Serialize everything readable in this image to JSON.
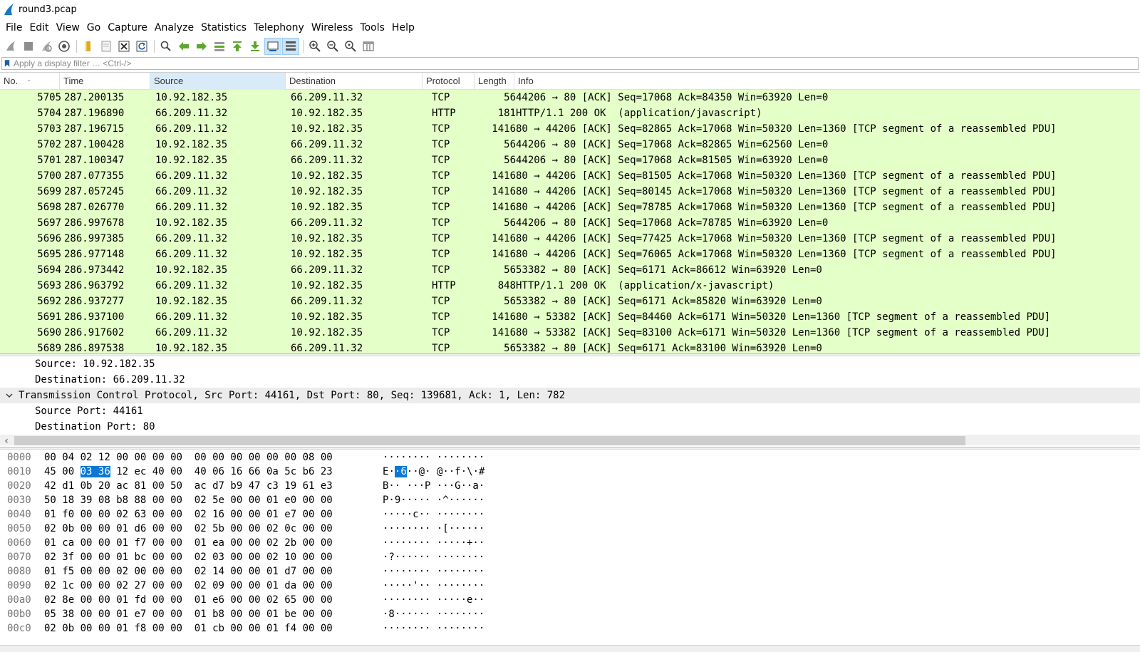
{
  "window": {
    "title": "round3.pcap"
  },
  "menu": [
    "File",
    "Edit",
    "View",
    "Go",
    "Capture",
    "Analyze",
    "Statistics",
    "Telephony",
    "Wireless",
    "Tools",
    "Help"
  ],
  "filter": {
    "placeholder": "Apply a display filter … <Ctrl-/>",
    "value": ""
  },
  "columns": [
    "No.",
    "Time",
    "Source",
    "Destination",
    "Protocol",
    "Length",
    "Info"
  ],
  "packets": [
    {
      "no": "5705",
      "time": "287.200135",
      "src": "10.92.182.35",
      "dst": "66.209.11.32",
      "proto": "TCP",
      "len": "56",
      "info": "44206 → 80 [ACK] Seq=17068 Ack=84350 Win=63920 Len=0"
    },
    {
      "no": "5704",
      "time": "287.196890",
      "src": "66.209.11.32",
      "dst": "10.92.182.35",
      "proto": "HTTP",
      "len": "181",
      "info": "HTTP/1.1 200 OK  (application/javascript)"
    },
    {
      "no": "5703",
      "time": "287.196715",
      "src": "66.209.11.32",
      "dst": "10.92.182.35",
      "proto": "TCP",
      "len": "1416",
      "info": "80 → 44206 [ACK] Seq=82865 Ack=17068 Win=50320 Len=1360 [TCP segment of a reassembled PDU]"
    },
    {
      "no": "5702",
      "time": "287.100428",
      "src": "10.92.182.35",
      "dst": "66.209.11.32",
      "proto": "TCP",
      "len": "56",
      "info": "44206 → 80 [ACK] Seq=17068 Ack=82865 Win=62560 Len=0"
    },
    {
      "no": "5701",
      "time": "287.100347",
      "src": "10.92.182.35",
      "dst": "66.209.11.32",
      "proto": "TCP",
      "len": "56",
      "info": "44206 → 80 [ACK] Seq=17068 Ack=81505 Win=63920 Len=0"
    },
    {
      "no": "5700",
      "time": "287.077355",
      "src": "66.209.11.32",
      "dst": "10.92.182.35",
      "proto": "TCP",
      "len": "1416",
      "info": "80 → 44206 [ACK] Seq=81505 Ack=17068 Win=50320 Len=1360 [TCP segment of a reassembled PDU]"
    },
    {
      "no": "5699",
      "time": "287.057245",
      "src": "66.209.11.32",
      "dst": "10.92.182.35",
      "proto": "TCP",
      "len": "1416",
      "info": "80 → 44206 [ACK] Seq=80145 Ack=17068 Win=50320 Len=1360 [TCP segment of a reassembled PDU]"
    },
    {
      "no": "5698",
      "time": "287.026770",
      "src": "66.209.11.32",
      "dst": "10.92.182.35",
      "proto": "TCP",
      "len": "1416",
      "info": "80 → 44206 [ACK] Seq=78785 Ack=17068 Win=50320 Len=1360 [TCP segment of a reassembled PDU]"
    },
    {
      "no": "5697",
      "time": "286.997678",
      "src": "10.92.182.35",
      "dst": "66.209.11.32",
      "proto": "TCP",
      "len": "56",
      "info": "44206 → 80 [ACK] Seq=17068 Ack=78785 Win=63920 Len=0"
    },
    {
      "no": "5696",
      "time": "286.997385",
      "src": "66.209.11.32",
      "dst": "10.92.182.35",
      "proto": "TCP",
      "len": "1416",
      "info": "80 → 44206 [ACK] Seq=77425 Ack=17068 Win=50320 Len=1360 [TCP segment of a reassembled PDU]"
    },
    {
      "no": "5695",
      "time": "286.977148",
      "src": "66.209.11.32",
      "dst": "10.92.182.35",
      "proto": "TCP",
      "len": "1416",
      "info": "80 → 44206 [ACK] Seq=76065 Ack=17068 Win=50320 Len=1360 [TCP segment of a reassembled PDU]"
    },
    {
      "no": "5694",
      "time": "286.973442",
      "src": "10.92.182.35",
      "dst": "66.209.11.32",
      "proto": "TCP",
      "len": "56",
      "info": "53382 → 80 [ACK] Seq=6171 Ack=86612 Win=63920 Len=0"
    },
    {
      "no": "5693",
      "time": "286.963792",
      "src": "66.209.11.32",
      "dst": "10.92.182.35",
      "proto": "HTTP",
      "len": "848",
      "info": "HTTP/1.1 200 OK  (application/x-javascript)"
    },
    {
      "no": "5692",
      "time": "286.937277",
      "src": "10.92.182.35",
      "dst": "66.209.11.32",
      "proto": "TCP",
      "len": "56",
      "info": "53382 → 80 [ACK] Seq=6171 Ack=85820 Win=63920 Len=0"
    },
    {
      "no": "5691",
      "time": "286.937100",
      "src": "66.209.11.32",
      "dst": "10.92.182.35",
      "proto": "TCP",
      "len": "1416",
      "info": "80 → 53382 [ACK] Seq=84460 Ack=6171 Win=50320 Len=1360 [TCP segment of a reassembled PDU]"
    },
    {
      "no": "5690",
      "time": "286.917602",
      "src": "66.209.11.32",
      "dst": "10.92.182.35",
      "proto": "TCP",
      "len": "1416",
      "info": "80 → 53382 [ACK] Seq=83100 Ack=6171 Win=50320 Len=1360 [TCP segment of a reassembled PDU]"
    },
    {
      "no": "5689",
      "time": "286.897538",
      "src": "10.92.182.35",
      "dst": "66.209.11.32",
      "proto": "TCP",
      "len": "56",
      "info": "53382 → 80 [ACK] Seq=6171 Ack=83100 Win=63920 Len=0"
    }
  ],
  "details": [
    {
      "text": "Source: 10.92.182.35",
      "indent": true,
      "toggle": "",
      "selected": false
    },
    {
      "text": "Destination: 66.209.11.32",
      "indent": true,
      "toggle": "",
      "selected": false
    },
    {
      "text": "Transmission Control Protocol, Src Port: 44161, Dst Port: 80, Seq: 139681, Ack: 1, Len: 782",
      "indent": false,
      "toggle": "expanded",
      "selected": true
    },
    {
      "text": "Source Port: 44161",
      "indent": true,
      "toggle": "",
      "selected": false
    },
    {
      "text": "Destination Port: 80",
      "indent": true,
      "toggle": "",
      "selected": false
    }
  ],
  "bytes": [
    {
      "offset": "0000",
      "hex": [
        "00",
        "04",
        "02",
        "12",
        "00",
        "00",
        "00",
        "00",
        "00",
        "00",
        "00",
        "00",
        "00",
        "00",
        "08",
        "00"
      ],
      "ascii": "········ ········"
    },
    {
      "offset": "0010",
      "hex": [
        "45",
        "00",
        "03",
        "36",
        "12",
        "ec",
        "40",
        "00",
        "40",
        "06",
        "16",
        "66",
        "0a",
        "5c",
        "b6",
        "23"
      ],
      "ascii": "E··6··@· @··f·\\·#",
      "highlight": [
        2,
        3
      ]
    },
    {
      "offset": "0020",
      "hex": [
        "42",
        "d1",
        "0b",
        "20",
        "ac",
        "81",
        "00",
        "50",
        "ac",
        "d7",
        "b9",
        "47",
        "c3",
        "19",
        "61",
        "e3"
      ],
      "ascii": "B·· ···P ···G··a·"
    },
    {
      "offset": "0030",
      "hex": [
        "50",
        "18",
        "39",
        "08",
        "b8",
        "88",
        "00",
        "00",
        "02",
        "5e",
        "00",
        "00",
        "01",
        "e0",
        "00",
        "00"
      ],
      "ascii": "P·9····· ·^······"
    },
    {
      "offset": "0040",
      "hex": [
        "01",
        "f0",
        "00",
        "00",
        "02",
        "63",
        "00",
        "00",
        "02",
        "16",
        "00",
        "00",
        "01",
        "e7",
        "00",
        "00"
      ],
      "ascii": "·····c·· ········"
    },
    {
      "offset": "0050",
      "hex": [
        "02",
        "0b",
        "00",
        "00",
        "01",
        "d6",
        "00",
        "00",
        "02",
        "5b",
        "00",
        "00",
        "02",
        "0c",
        "00",
        "00"
      ],
      "ascii": "········ ·[······"
    },
    {
      "offset": "0060",
      "hex": [
        "01",
        "ca",
        "00",
        "00",
        "01",
        "f7",
        "00",
        "00",
        "01",
        "ea",
        "00",
        "00",
        "02",
        "2b",
        "00",
        "00"
      ],
      "ascii": "········ ·····+··"
    },
    {
      "offset": "0070",
      "hex": [
        "02",
        "3f",
        "00",
        "00",
        "01",
        "bc",
        "00",
        "00",
        "02",
        "03",
        "00",
        "00",
        "02",
        "10",
        "00",
        "00"
      ],
      "ascii": "·?······ ········"
    },
    {
      "offset": "0080",
      "hex": [
        "01",
        "f5",
        "00",
        "00",
        "02",
        "00",
        "00",
        "00",
        "02",
        "14",
        "00",
        "00",
        "01",
        "d7",
        "00",
        "00"
      ],
      "ascii": "········ ········"
    },
    {
      "offset": "0090",
      "hex": [
        "02",
        "1c",
        "00",
        "00",
        "02",
        "27",
        "00",
        "00",
        "02",
        "09",
        "00",
        "00",
        "01",
        "da",
        "00",
        "00"
      ],
      "ascii": "·····'·· ········"
    },
    {
      "offset": "00a0",
      "hex": [
        "02",
        "8e",
        "00",
        "00",
        "01",
        "fd",
        "00",
        "00",
        "01",
        "e6",
        "00",
        "00",
        "02",
        "65",
        "00",
        "00"
      ],
      "ascii": "········ ·····e··"
    },
    {
      "offset": "00b0",
      "hex": [
        "05",
        "38",
        "00",
        "00",
        "01",
        "e7",
        "00",
        "00",
        "01",
        "b8",
        "00",
        "00",
        "01",
        "be",
        "00",
        "00"
      ],
      "ascii": "·8······ ········"
    },
    {
      "offset": "00c0",
      "hex": [
        "02",
        "0b",
        "00",
        "00",
        "01",
        "f8",
        "00",
        "00",
        "01",
        "cb",
        "00",
        "00",
        "01",
        "f4",
        "00",
        "00"
      ],
      "ascii": "········ ········"
    }
  ],
  "colors": {
    "row_bg": "#e4ffc7",
    "selection": "#0b78d7",
    "header_sorted": "#d9ebf9"
  }
}
